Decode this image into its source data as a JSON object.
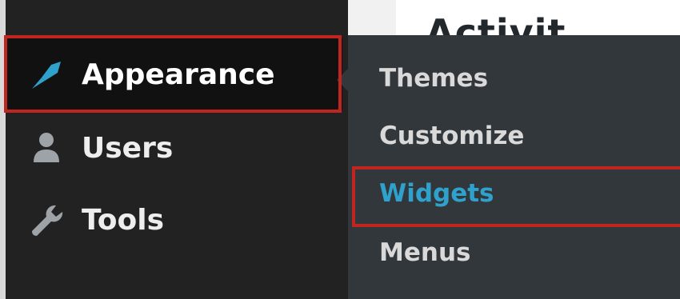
{
  "content": {
    "heading": "Activit"
  },
  "sidebar": {
    "items": [
      {
        "label": "Appearance",
        "icon": "paintbrush-icon"
      },
      {
        "label": "Users",
        "icon": "user-icon"
      },
      {
        "label": "Tools",
        "icon": "wrench-icon"
      }
    ]
  },
  "submenu": {
    "items": [
      {
        "label": "Themes"
      },
      {
        "label": "Customize"
      },
      {
        "label": "Widgets"
      },
      {
        "label": "Menus"
      }
    ]
  },
  "colors": {
    "sidebar_bg": "#222222",
    "submenu_bg": "#32373c",
    "accent_blue": "#2ea2cc",
    "highlight_red": "#c0251f"
  }
}
